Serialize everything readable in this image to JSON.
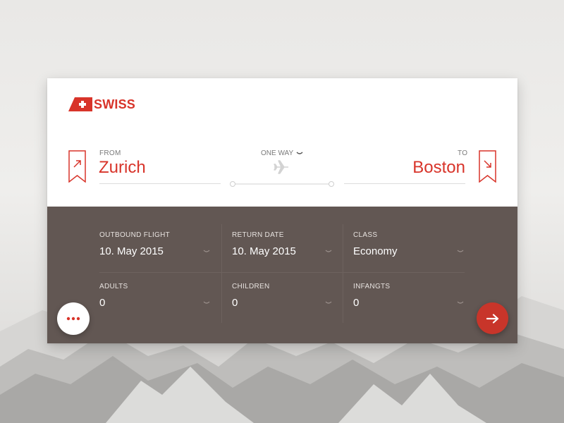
{
  "brand": {
    "name": "SWISS",
    "accent": "#d8342a",
    "panel": "#625753"
  },
  "route": {
    "from_label": "FROM",
    "from_city": "Zurich",
    "to_label": "TO",
    "to_city": "Boston",
    "trip_type": "ONE WAY"
  },
  "fields": {
    "outbound": {
      "label": "OUTBOUND FLIGHT",
      "value": "10. May 2015"
    },
    "return": {
      "label": "RETURN DATE",
      "value": "10. May 2015"
    },
    "class": {
      "label": "CLASS",
      "value": "Economy"
    },
    "adults": {
      "label": "ADULTS",
      "value": "0"
    },
    "children": {
      "label": "CHILDREN",
      "value": "0"
    },
    "infants": {
      "label": "INFANGTS",
      "value": "0"
    }
  },
  "icons": {
    "departure": "departure-flag-icon",
    "arrival": "arrival-flag-icon",
    "plane": "plane-icon",
    "more": "more-dots-icon",
    "submit": "arrow-right-icon"
  }
}
